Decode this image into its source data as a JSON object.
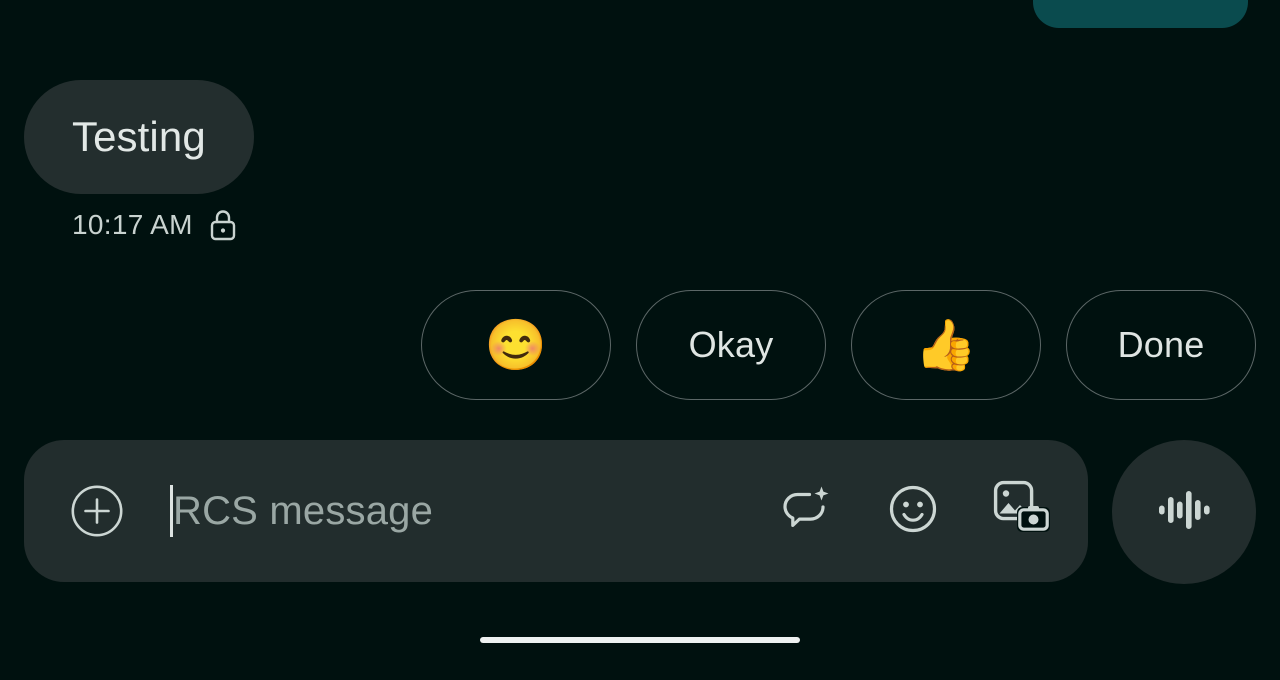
{
  "theme": {
    "background": "#00110f",
    "incoming_bubble": "#232e2e",
    "outgoing_bubble": "#0a4b4e",
    "composer_surface": "#222d2d",
    "chip_border": "#5c6767",
    "primary_text": "#e2e8e6",
    "secondary_text": "#9aa7a4",
    "home_indicator": "#eef2f1"
  },
  "conversation": {
    "outgoing_partial": {
      "name": "outgoing-message-bubble",
      "visible_text": ""
    },
    "incoming_message": {
      "text": "Testing",
      "timestamp": "10:17 AM",
      "encryption_icon": "lock-icon"
    }
  },
  "suggestions": {
    "chips": [
      {
        "label": "😊",
        "kind": "emoji",
        "icon_name": "smiling-face-emoji"
      },
      {
        "label": "Okay",
        "kind": "text",
        "icon_name": "okay-suggestion"
      },
      {
        "label": "👍",
        "kind": "emoji",
        "icon_name": "thumbs-up-emoji"
      },
      {
        "label": "Done",
        "kind": "text",
        "icon_name": "done-suggestion"
      }
    ]
  },
  "composer": {
    "placeholder": "RCS message",
    "value": "",
    "attach_icon": "plus-circle-icon",
    "actions": [
      {
        "icon_name": "magic-compose-icon"
      },
      {
        "icon_name": "emoji-icon"
      },
      {
        "icon_name": "gallery-camera-icon"
      }
    ],
    "voice_button": {
      "icon_name": "voice-waveform-icon"
    }
  },
  "system": {
    "home_indicator": "home-indicator"
  }
}
